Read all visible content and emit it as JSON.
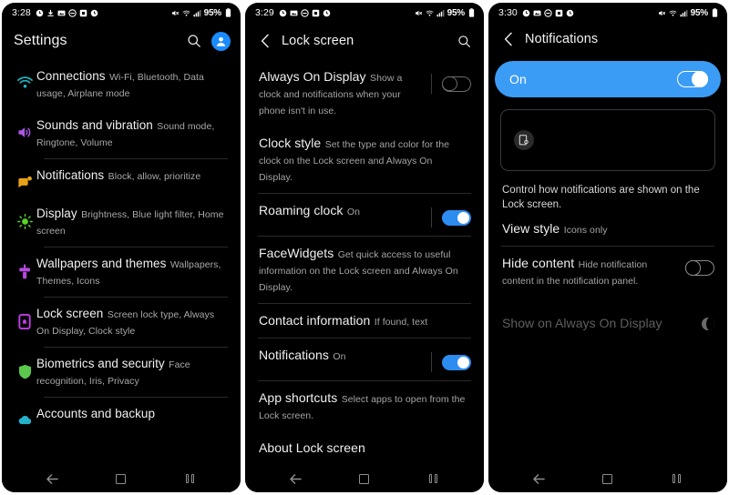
{
  "screens": [
    {
      "name": "settings",
      "statusbar": {
        "time": "3:28",
        "battery": "95%",
        "left_icons": [
          "alarm-icon",
          "download-icon",
          "image-icon",
          "do-not-disturb-icon",
          "app-icon",
          "clock-icon"
        ],
        "right_icons": [
          "mute-icon",
          "wifi-icon",
          "signal-icon",
          "battery-icon"
        ]
      },
      "appbar": {
        "title": "Settings",
        "search": "search-icon",
        "avatar": "account-avatar"
      },
      "items": [
        {
          "title": "Connections",
          "subtitle": "Wi-Fi, Bluetooth, Data usage, Airplane mode",
          "icon": "wifi-icon",
          "color": "#19b8c4"
        },
        {
          "title": "Sounds and vibration",
          "subtitle": "Sound mode, Ringtone, Volume",
          "icon": "speaker-icon",
          "color": "#aa55e6"
        },
        {
          "title": "Notifications",
          "subtitle": "Block, allow, prioritize",
          "icon": "notification-icon",
          "color": "#e8a117"
        },
        {
          "title": "Display",
          "subtitle": "Brightness, Blue light filter, Home screen",
          "icon": "brightness-icon",
          "color": "#5ad321"
        },
        {
          "title": "Wallpapers and themes",
          "subtitle": "Wallpapers, Themes, Icons",
          "icon": "paintbrush-icon",
          "color": "#b44ae0"
        },
        {
          "title": "Lock screen",
          "subtitle": "Screen lock type, Always On Display, Clock style",
          "icon": "lock-icon",
          "color": "#c13de8"
        },
        {
          "title": "Biometrics and security",
          "subtitle": "Face recognition, Iris, Privacy",
          "icon": "shield-icon",
          "color": "#5ac94e"
        },
        {
          "title": "Accounts and backup",
          "subtitle": "",
          "icon": "cloud-icon",
          "color": "#26b0c9"
        }
      ]
    },
    {
      "name": "lock-screen",
      "statusbar": {
        "time": "3:29",
        "battery": "95%"
      },
      "appbar": {
        "back": "back-arrow-icon",
        "title": "Lock screen",
        "search": "search-icon"
      },
      "items": [
        {
          "title": "Always On Display",
          "subtitle": "Show a clock and notifications when your phone isn't in use.",
          "toggle": "off"
        },
        {
          "title": "Clock style",
          "subtitle": "Set the type and color for the clock on the Lock screen and Always On Display."
        },
        {
          "title": "Roaming clock",
          "subtitle": "On",
          "subtitle_style": "accent",
          "toggle": "on"
        },
        {
          "title": "FaceWidgets",
          "subtitle": "Get quick access to useful information on the Lock screen and Always On Display."
        },
        {
          "title": "Contact information",
          "subtitle": "If found, text",
          "subtitle_style": "accentblue"
        },
        {
          "title": "Notifications",
          "subtitle": "On",
          "subtitle_style": "accent",
          "toggle": "on"
        },
        {
          "title": "App shortcuts",
          "subtitle": "Select apps to open from the Lock screen."
        },
        {
          "title": "About Lock screen",
          "subtitle": ""
        }
      ]
    },
    {
      "name": "notifications",
      "statusbar": {
        "time": "3:30",
        "battery": "95%"
      },
      "appbar": {
        "back": "back-arrow-icon",
        "title": "Notifications"
      },
      "master": {
        "label": "On",
        "state": "on"
      },
      "preview": {
        "badge_icon": "notification-preview-icon",
        "description": "Control how notifications are shown on the Lock screen."
      },
      "items": [
        {
          "title": "View style",
          "subtitle": "Icons only"
        },
        {
          "title": "Hide content",
          "subtitle": "Hide notification content in the notification panel.",
          "toggle": "off"
        },
        {
          "title": "Show on Always On Display",
          "subtitle": "",
          "disabled": true,
          "toggle": "moon"
        }
      ]
    }
  ],
  "navbar": {
    "back": "back-nav-icon",
    "home": "home-nav-icon",
    "recents": "recents-nav-icon"
  }
}
